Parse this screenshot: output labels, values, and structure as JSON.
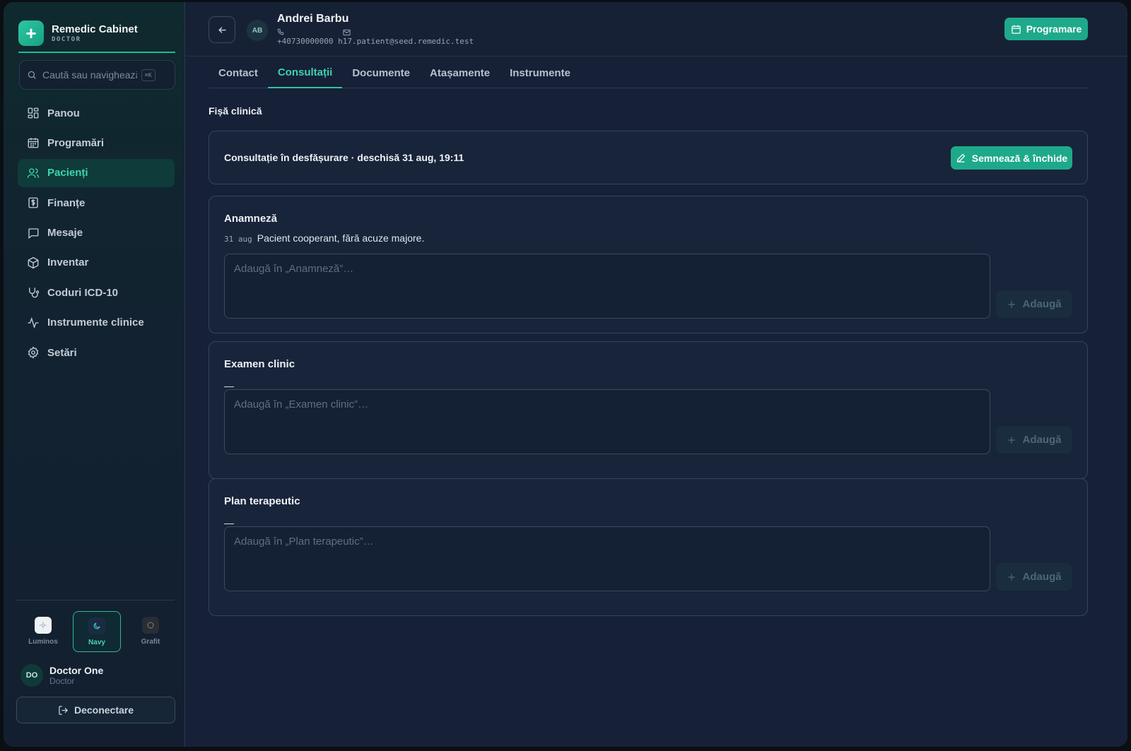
{
  "brand": {
    "name": "Remedic Cabinet",
    "role": "DOCTOR",
    "logo_icon": "plus-icon"
  },
  "search": {
    "placeholder": "Caută sau navighează",
    "shortcut": "⌘K"
  },
  "sidebar": {
    "items": [
      {
        "label": "Panou",
        "icon": "dashboard-icon",
        "active": false
      },
      {
        "label": "Programări",
        "icon": "calendar-icon",
        "active": false
      },
      {
        "label": "Pacienți",
        "icon": "users-icon",
        "active": true
      },
      {
        "label": "Finanțe",
        "icon": "dollar-receipt-icon",
        "active": false
      },
      {
        "label": "Mesaje",
        "icon": "message-icon",
        "active": false
      },
      {
        "label": "Inventar",
        "icon": "box-icon",
        "active": false
      },
      {
        "label": "Coduri ICD-10",
        "icon": "stethoscope-icon",
        "active": false
      },
      {
        "label": "Instrumente clinice",
        "icon": "activity-icon",
        "active": false
      },
      {
        "label": "Setări",
        "icon": "gear-icon",
        "active": false
      }
    ]
  },
  "themes": [
    {
      "label": "Luminos",
      "icon": "sun-icon",
      "active": false
    },
    {
      "label": "Navy",
      "icon": "moon-icon",
      "active": true
    },
    {
      "label": "Grafit",
      "icon": "circle-icon",
      "active": false
    }
  ],
  "user": {
    "initials": "DO",
    "name": "Doctor One",
    "role": "Doctor"
  },
  "logout_label": "Deconectare",
  "header": {
    "initials": "AB",
    "patient_name": "Andrei Barbu",
    "phone": "+40730000000",
    "email": "h17.patient@seed.remedic.test",
    "programare_label": "Programare"
  },
  "tabs": [
    {
      "label": "Contact",
      "active": false
    },
    {
      "label": "Consultații",
      "active": true
    },
    {
      "label": "Documente",
      "active": false
    },
    {
      "label": "Atașamente",
      "active": false
    },
    {
      "label": "Instrumente",
      "active": false
    }
  ],
  "section_title": "Fișă clinică",
  "status": {
    "text": "Consultație în desfășurare · deschisă 31 aug, 19:11",
    "sign_label": "Semnează & închide"
  },
  "notes": [
    {
      "title": "Anamneză",
      "entries": [
        {
          "date": "31 aug",
          "text": "Pacient cooperant, fără acuze majore."
        }
      ],
      "empty": "",
      "placeholder": "Adaugă în „Anamneză”…",
      "add_label": "Adaugă"
    },
    {
      "title": "Examen clinic",
      "entries": [],
      "empty": "—",
      "placeholder": "Adaugă în „Examen clinic”…",
      "add_label": "Adaugă"
    },
    {
      "title": "Plan terapeutic",
      "entries": [],
      "empty": "—",
      "placeholder": "Adaugă în „Plan terapeutic”…",
      "add_label": "Adaugă"
    }
  ],
  "colors": {
    "accent": "#1ea98b",
    "accent_text": "#3fd2ae",
    "background": "#162037"
  }
}
